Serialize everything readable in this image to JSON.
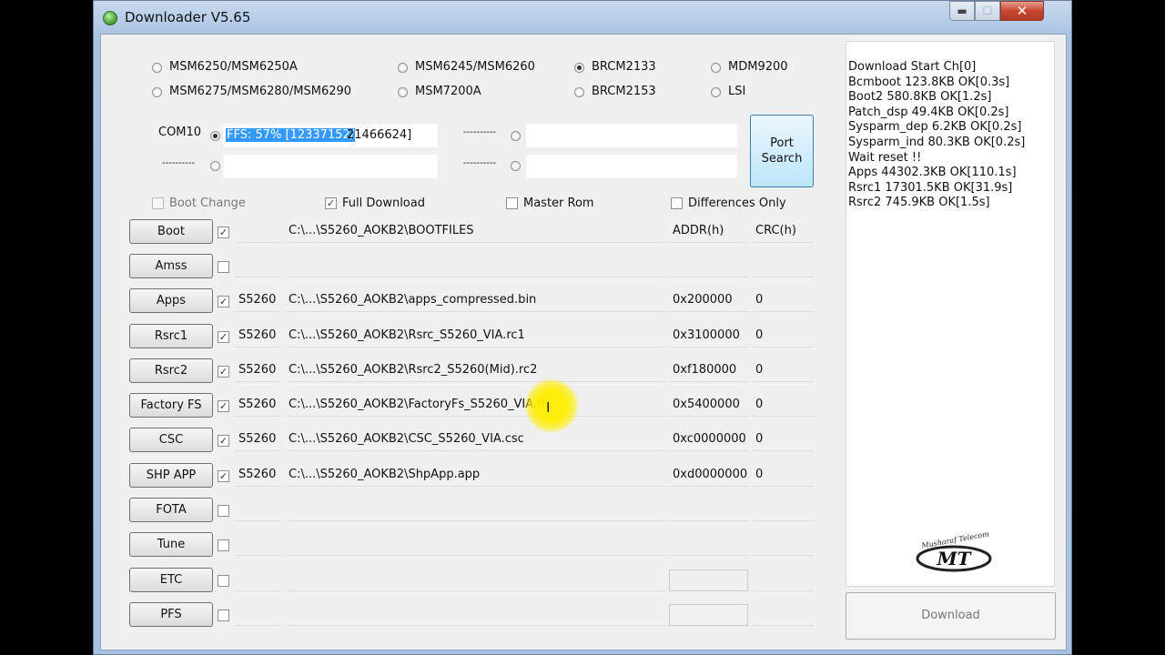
{
  "window": {
    "title": "Downloader V5.65",
    "min": "▬",
    "max": "☐",
    "close": "✕"
  },
  "chipsets": [
    {
      "label": "MSM6250/MSM6250A",
      "selected": false
    },
    {
      "label": "MSM6245/MSM6260",
      "selected": false
    },
    {
      "label": "BRCM2133",
      "selected": true
    },
    {
      "label": "MDM9200",
      "selected": false
    },
    {
      "label": "MSM6275/MSM6280/MSM6290",
      "selected": false
    },
    {
      "label": "MSM7200A",
      "selected": false
    },
    {
      "label": "BRCM2153",
      "selected": false
    },
    {
      "label": "LSI",
      "selected": false
    }
  ],
  "ports": {
    "com_label": "COM10",
    "progress_text_highlight": "FFS:  57% [12337152/",
    "progress_text_rest": "21466624]",
    "placeholder": "----------"
  },
  "port_search": {
    "line1": "Port",
    "line2": "Search"
  },
  "options": {
    "boot_change": {
      "label": "Boot Change",
      "checked": false
    },
    "full_download": {
      "label": "Full Download",
      "checked": true
    },
    "master_rom": {
      "label": "Master Rom",
      "checked": false
    },
    "differences_only": {
      "label": "Differences Only",
      "checked": false
    }
  },
  "headers": {
    "addr": "ADDR(h)",
    "crc": "CRC(h)"
  },
  "rows": [
    {
      "label": "Boot",
      "checked": true,
      "model": "",
      "path": "C:\\...\\S5260_AOKB2\\BOOTFILES",
      "addr": "ADDR(h)",
      "crc": "CRC(h)"
    },
    {
      "label": "Amss",
      "checked": false,
      "model": "",
      "path": "",
      "addr": "",
      "crc": ""
    },
    {
      "label": "Apps",
      "checked": true,
      "model": "S5260",
      "path": "C:\\...\\S5260_AOKB2\\apps_compressed.bin",
      "addr": "0x200000",
      "crc": "0"
    },
    {
      "label": "Rsrc1",
      "checked": true,
      "model": "S5260",
      "path": "C:\\...\\S5260_AOKB2\\Rsrc_S5260_VIA.rc1",
      "addr": "0x3100000",
      "crc": "0"
    },
    {
      "label": "Rsrc2",
      "checked": true,
      "model": "S5260",
      "path": "C:\\...\\S5260_AOKB2\\Rsrc2_S5260(Mid).rc2",
      "addr": "0xf180000",
      "crc": "0"
    },
    {
      "label": "Factory FS",
      "checked": true,
      "model": "S5260",
      "path": "C:\\...\\S5260_AOKB2\\FactoryFs_S5260_VIA.ffs",
      "addr": "0x5400000",
      "crc": "0"
    },
    {
      "label": "CSC",
      "checked": true,
      "model": "S5260",
      "path": "C:\\...\\S5260_AOKB2\\CSC_S5260_VIA.csc",
      "addr": "0xc0000000",
      "crc": "0"
    },
    {
      "label": "SHP APP",
      "checked": true,
      "model": "S5260",
      "path": "C:\\...\\S5260_AOKB2\\ShpApp.app",
      "addr": "0xd0000000",
      "crc": "0"
    },
    {
      "label": "FOTA",
      "checked": false,
      "model": "",
      "path": "",
      "addr": "",
      "crc": ""
    },
    {
      "label": "Tune",
      "checked": false,
      "model": "",
      "path": "",
      "addr": "",
      "crc": ""
    },
    {
      "label": "ETC",
      "checked": false,
      "model": "",
      "path": "",
      "addr": "",
      "crc": ""
    },
    {
      "label": "PFS",
      "checked": false,
      "model": "",
      "path": "",
      "addr": "",
      "crc": ""
    }
  ],
  "log": [
    "Download Start Ch[0]",
    "Bcmboot 123.8KB OK[0.3s]",
    "Boot2 580.8KB OK[1.2s]",
    "Patch_dsp 49.4KB OK[0.2s]",
    "Sysparm_dep 6.2KB OK[0.2s]",
    "Sysparm_ind 80.3KB OK[0.2s]",
    "Wait reset !!",
    "Apps 44302.3KB OK[110.1s]",
    "Rsrc1 17301.5KB OK[31.9s]",
    "Rsrc2 745.9KB OK[1.5s]"
  ],
  "logo": {
    "text": "Musharaf Telecom",
    "mark": "MT"
  },
  "download_button": "Download",
  "colors": {
    "selection": "#3399ff",
    "cursor_highlight": "#ffee00"
  }
}
